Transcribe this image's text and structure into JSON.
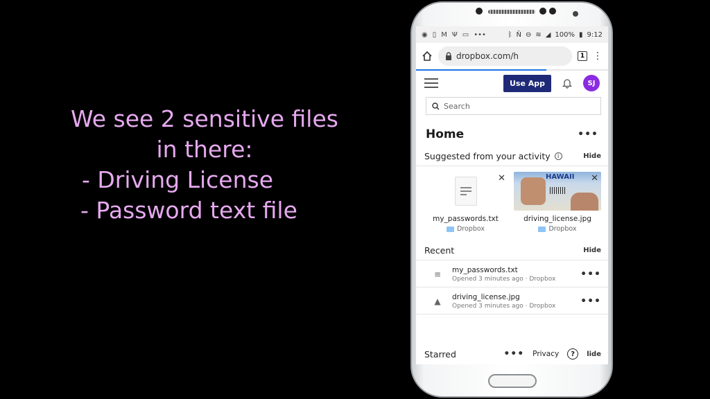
{
  "caption": {
    "line1": "We see 2 sensitive files",
    "line2": "in there:",
    "item1": "- Driving License",
    "item2": "- Password text file"
  },
  "statusbar": {
    "battery": "100%",
    "time": "9:12"
  },
  "browser": {
    "url": "dropbox.com/h",
    "tab_count": "1"
  },
  "header": {
    "use_app_label": "Use App",
    "avatar_initials": "SJ"
  },
  "search": {
    "placeholder": "Search"
  },
  "home": {
    "title": "Home",
    "more": "•••"
  },
  "suggested": {
    "title": "Suggested from your activity",
    "hide_label": "Hide",
    "cards": [
      {
        "name": "my_passwords.txt",
        "folder": "Dropbox"
      },
      {
        "name": "driving_license.jpg",
        "folder": "Dropbox",
        "thumb_text": "HAWAII"
      }
    ]
  },
  "recent": {
    "title": "Recent",
    "hide_label": "Hide",
    "items": [
      {
        "name": "my_passwords.txt",
        "meta": "Opened 3 minutes ago · Dropbox"
      },
      {
        "name": "driving_license.jpg",
        "meta": "Opened 3 minutes ago · Dropbox"
      }
    ]
  },
  "footer": {
    "starred": "Starred",
    "more": "•••",
    "privacy": "Privacy",
    "help": "?",
    "hide_fragment": "lide"
  },
  "colors": {
    "caption": "#e6a9ef",
    "use_app_bg": "#1e2a78",
    "avatar_bg": "#8a2be2"
  }
}
